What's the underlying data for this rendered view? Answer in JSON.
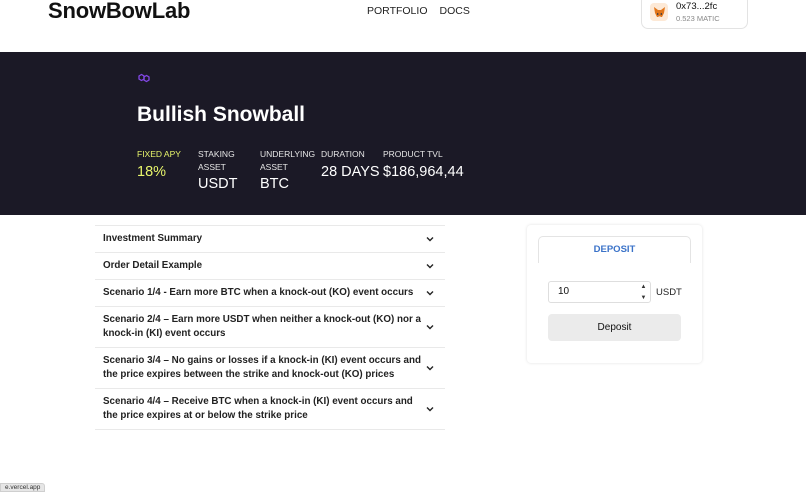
{
  "header": {
    "logo": "SnowBowLab",
    "nav": {
      "portfolio": "PORTFOLIO",
      "docs": "DOCS"
    },
    "wallet": {
      "address": "0x73...2fc",
      "balance": "0.523 MATIC",
      "icon": "metamask-fox-icon"
    }
  },
  "hero": {
    "chain_icon": "polygon-icon",
    "title": "Bullish Snowball",
    "stats": [
      {
        "label": "FIXED APY",
        "value": "18%"
      },
      {
        "label": "STAKING ASSET",
        "value": "USDT"
      },
      {
        "label": "UNDERLYING ASSET",
        "value": "BTC"
      },
      {
        "label": "DURATION",
        "value": "28 DAYS"
      },
      {
        "label": "PRODUCT TVL",
        "value": "$186,964,44"
      }
    ]
  },
  "accordion": [
    {
      "label": "Investment Summary"
    },
    {
      "label": "Order Detail Example"
    },
    {
      "label": "Scenario 1/4 - Earn more BTC when a knock-out (KO) event occurs"
    },
    {
      "label": "Scenario 2/4 – Earn more USDT when neither a knock-out (KO) nor a knock-in (KI) event occurs"
    },
    {
      "label": "Scenario 3/4 – No gains or losses if a knock-in (KI) event occurs and the price expires between the strike and knock-out (KO) prices"
    },
    {
      "label": "Scenario 4/4 – Receive BTC when a knock-in (KI) event occurs and the price expires at or below the strike price"
    }
  ],
  "deposit": {
    "tab": "DEPOSIT",
    "amount": "10",
    "unit": "USDT",
    "button": "Deposit"
  },
  "status_bar": "e.vercel.app",
  "colors": {
    "hero_bg": "#1b1926",
    "accent_yellow": "#e8f56b",
    "tab_blue": "#3a72c8",
    "polygon_purple": "#8247e5"
  }
}
